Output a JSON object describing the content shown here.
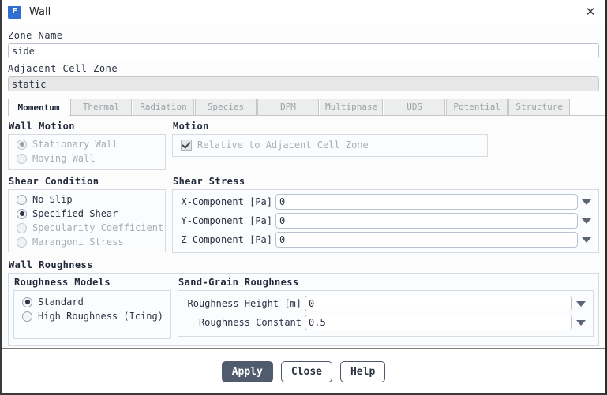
{
  "window": {
    "title": "Wall",
    "app_icon": "fluent-app-icon",
    "app_icon_letter": "F",
    "close_label": "✕"
  },
  "fields": {
    "zone_name_label": "Zone Name",
    "zone_name_value": "side",
    "adjacent_cell_zone_label": "Adjacent Cell Zone",
    "adjacent_cell_zone_value": "static"
  },
  "tabs": [
    {
      "label": "Momentum",
      "active": true
    },
    {
      "label": "Thermal",
      "active": false
    },
    {
      "label": "Radiation",
      "active": false
    },
    {
      "label": "Species",
      "active": false
    },
    {
      "label": "DPM",
      "active": false
    },
    {
      "label": "Multiphase",
      "active": false
    },
    {
      "label": "UDS",
      "active": false
    },
    {
      "label": "Potential",
      "active": false
    },
    {
      "label": "Structure",
      "active": false
    }
  ],
  "wall_motion": {
    "title": "Wall Motion",
    "options": [
      {
        "label": "Stationary Wall",
        "selected": true,
        "disabled": true
      },
      {
        "label": "Moving Wall",
        "selected": false,
        "disabled": true
      }
    ]
  },
  "motion": {
    "title": "Motion",
    "checkbox_label": "Relative to Adjacent Cell Zone",
    "checked": true,
    "disabled": true
  },
  "shear_condition": {
    "title": "Shear Condition",
    "options": [
      {
        "label": "No Slip",
        "selected": false,
        "disabled": false
      },
      {
        "label": "Specified Shear",
        "selected": true,
        "disabled": false
      },
      {
        "label": "Specularity Coefficient",
        "selected": false,
        "disabled": true
      },
      {
        "label": "Marangoni Stress",
        "selected": false,
        "disabled": true
      }
    ]
  },
  "shear_stress": {
    "title": "Shear Stress",
    "rows": [
      {
        "label": "X-Component [Pa]",
        "value": "0"
      },
      {
        "label": "Y-Component [Pa]",
        "value": "0"
      },
      {
        "label": "Z-Component [Pa]",
        "value": "0"
      }
    ]
  },
  "wall_roughness": {
    "title": "Wall Roughness",
    "models": {
      "title": "Roughness Models",
      "options": [
        {
          "label": "Standard",
          "selected": true,
          "disabled": false
        },
        {
          "label": "High Roughness (Icing)",
          "selected": false,
          "disabled": false
        }
      ]
    },
    "sand_grain": {
      "title": "Sand-Grain Roughness",
      "rows": [
        {
          "label": "Roughness Height [m]",
          "value": "0"
        },
        {
          "label": "Roughness Constant",
          "value": "0.5"
        }
      ]
    }
  },
  "footer": {
    "apply_label": "Apply",
    "close_label": "Close",
    "help_label": "Help"
  },
  "colors": {
    "accent": "#505b6d",
    "icon_blue": "#2f6fd0",
    "text": "#2b3243",
    "disabled_text": "#a8adb4",
    "group_border": "#d5dbe3"
  }
}
